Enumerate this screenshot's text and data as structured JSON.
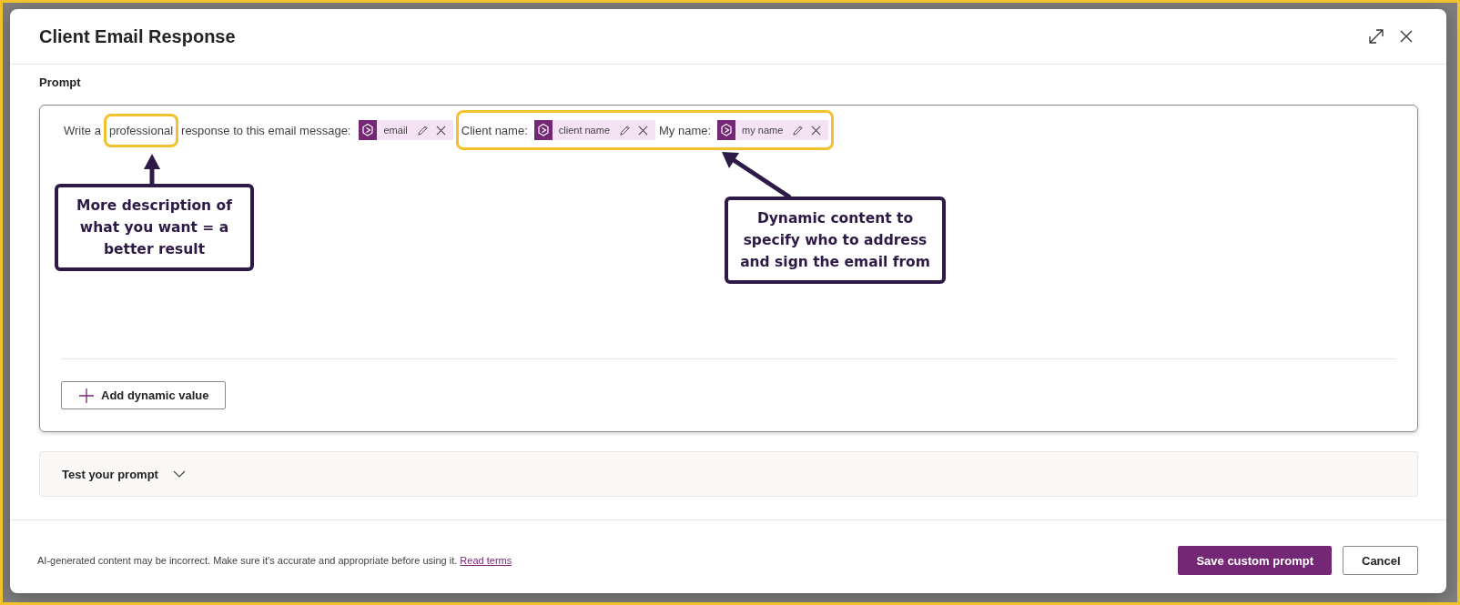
{
  "dialog": {
    "title": "Client Email Response"
  },
  "prompt": {
    "label": "Prompt",
    "segments": [
      {
        "kind": "text",
        "text": "Write a",
        "highlighted": false
      },
      {
        "kind": "text",
        "text": "professional",
        "highlighted": true
      },
      {
        "kind": "text",
        "text": "response to this email message:",
        "highlighted": false
      },
      {
        "kind": "chip",
        "text": "email",
        "highlighted": false
      },
      {
        "kind": "text",
        "text": "Client name:",
        "highlighted": true
      },
      {
        "kind": "chip",
        "text": "client name",
        "highlighted": true
      },
      {
        "kind": "text",
        "text": "My name:",
        "highlighted": true
      },
      {
        "kind": "chip",
        "text": "my name",
        "highlighted": true
      }
    ],
    "add_button": "Add dynamic value"
  },
  "callouts": [
    {
      "text": "More description of what you want = a better result"
    },
    {
      "text": "Dynamic content to specify who to address and sign the email from"
    }
  ],
  "test_panel": {
    "title": "Test your prompt",
    "expanded": false
  },
  "footer": {
    "disclaimer": "AI-generated content may be incorrect. Make sure it's accurate and appropriate before using it.",
    "link": "Read terms",
    "primary_button": "Save custom prompt",
    "secondary_button": "Cancel"
  }
}
